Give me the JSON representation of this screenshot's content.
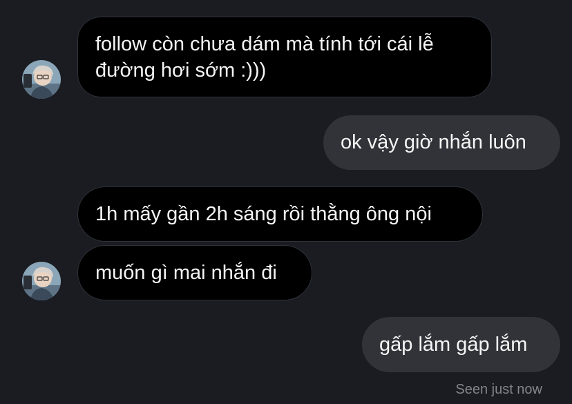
{
  "messages": [
    {
      "sender": "them",
      "text_line1": "follow còn chưa dám mà tính tới cái lễ",
      "text_line2": "đường hơi sớm :)))"
    },
    {
      "sender": "me",
      "text": "ok vậy giờ nhắn luôn"
    },
    {
      "sender": "them",
      "text": "1h mấy gần 2h sáng rồi thằng ông nội"
    },
    {
      "sender": "them",
      "text": "muốn gì mai nhắn đi"
    },
    {
      "sender": "me",
      "text": "gấp lắm gấp lắm"
    }
  ],
  "status": {
    "seen": "Seen just now"
  },
  "colors": {
    "background": "#1a1c22",
    "incoming_bubble": "#000000",
    "outgoing_bubble": "#323338",
    "text": "#f5f5f5",
    "seen_text": "#84858b"
  }
}
